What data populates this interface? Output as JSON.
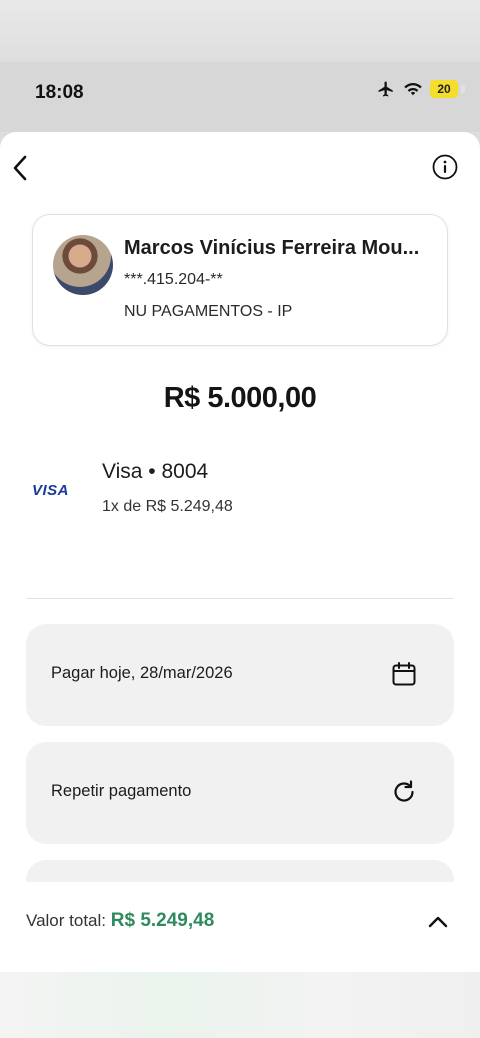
{
  "status": {
    "time": "18:08",
    "battery": "20"
  },
  "icons": {
    "back": "chevron-left-icon",
    "info": "info-icon",
    "calendar": "calendar-icon",
    "repeat": "refresh-icon",
    "expand": "chevron-up-icon",
    "airplane": "airplane-icon",
    "wifi": "wifi-icon"
  },
  "recipient": {
    "name": "Marcos Vinícius Ferreira Mou...",
    "document": "***.415.204-**",
    "bank": "NU PAGAMENTOS - IP"
  },
  "amount": "R$ 5.000,00",
  "payment_method": {
    "brand": "VISA",
    "card": "Visa • 8004",
    "installments": "1x de R$ 5.249,48"
  },
  "options": [
    {
      "label": "Pagar hoje, 28/mar/2026"
    },
    {
      "label": "Repetir pagamento"
    }
  ],
  "footer": {
    "total_label": "Valor total:",
    "total_value": "R$ 5.249,48"
  },
  "colors": {
    "accent_green": "#2f8a5e",
    "visa_blue": "#1a3a9a",
    "battery_yellow": "#f5dd2c"
  }
}
